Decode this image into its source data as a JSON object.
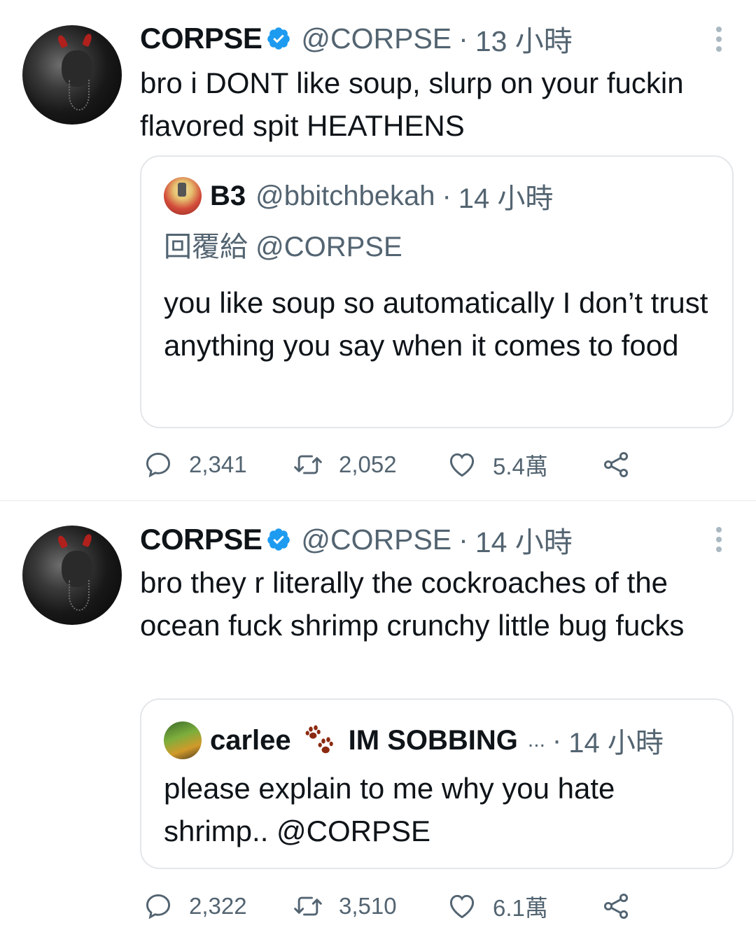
{
  "tweets": [
    {
      "author": {
        "name": "CORPSE",
        "handle": "@CORPSE",
        "verified": true,
        "avatar_icon": "dark-horned-avatar"
      },
      "time": "13 小時",
      "text": "bro i DONT like soup, slurp on your fuckin flavored spit HEATHENS",
      "quote": {
        "author": {
          "name": "B3",
          "handle": "@bbitchbekah"
        },
        "time": "14 小時",
        "reply_to": "回覆給 @CORPSE",
        "text": "you like soup so automatically I don’t trust anything you say when it comes to food"
      },
      "stats": {
        "replies": "2,341",
        "retweets": "2,052",
        "likes": "5.4萬"
      }
    },
    {
      "author": {
        "name": "CORPSE",
        "handle": "@CORPSE",
        "verified": true,
        "avatar_icon": "dark-horned-avatar"
      },
      "time": "14 小時",
      "text": "bro they r literally the cockroaches of the ocean fuck shrimp crunchy little bug fucks",
      "quote": {
        "author": {
          "name": "carlee",
          "name_suffix": "IM SOBBING",
          "ellipsis": "...",
          "emoji": "paw-prints-icon"
        },
        "time": "14 小時",
        "text": "please explain to me why you hate shrimp.. @CORPSE"
      },
      "stats": {
        "replies": "2,322",
        "retweets": "3,510",
        "likes": "6.1萬"
      }
    }
  ],
  "colors": {
    "verified": "#1d9bf0",
    "secondary_text": "#536471",
    "border": "#e3e7ea",
    "paw": "#8b2a10"
  }
}
